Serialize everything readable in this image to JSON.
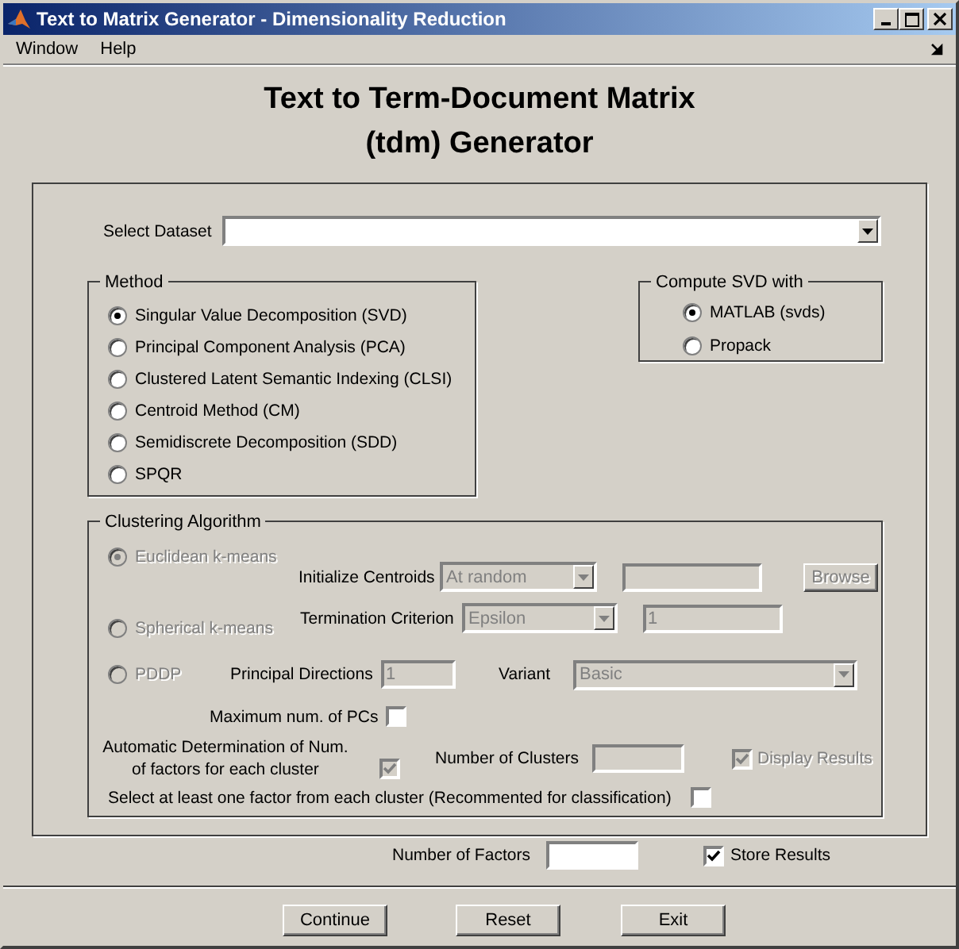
{
  "window": {
    "title": "Text to Matrix Generator - Dimensionality Reduction"
  },
  "menu": [
    "Window",
    "Help"
  ],
  "heading_lines": [
    "Text to Term-Document Matrix",
    "(tdm) Generator"
  ],
  "dataset": {
    "label": "Select Dataset"
  },
  "method": {
    "title": "Method",
    "options": [
      {
        "label": "Singular Value Decomposition (SVD)",
        "selected": true
      },
      {
        "label": "Principal Component Analysis (PCA)",
        "selected": false
      },
      {
        "label": "Clustered Latent Semantic Indexing (CLSI)",
        "selected": false
      },
      {
        "label": "Centroid Method (CM)",
        "selected": false
      },
      {
        "label": "Semidiscrete Decomposition (SDD)",
        "selected": false
      },
      {
        "label": "SPQR",
        "selected": false
      }
    ]
  },
  "svd": {
    "title": "Compute SVD with",
    "options": [
      {
        "label": "MATLAB (svds)",
        "selected": true
      },
      {
        "label": "Propack",
        "selected": false
      }
    ]
  },
  "clustering": {
    "title": "Clustering Algorithm",
    "disabled": true,
    "algorithms": [
      {
        "label": "Euclidean k-means",
        "selected": true
      },
      {
        "label": "Spherical k-means",
        "selected": false
      },
      {
        "label": "PDDP",
        "selected": false
      }
    ],
    "init_centroids": {
      "label": "Initialize Centroids",
      "value": "At random"
    },
    "browse": "Browse",
    "termination": {
      "label": "Termination Criterion",
      "value": "Epsilon",
      "tolerance": "1"
    },
    "principal_directions": {
      "label": "Principal Directions",
      "value": "1"
    },
    "variant": {
      "label": "Variant",
      "value": "Basic"
    },
    "max_pcs": {
      "label": "Maximum num. of PCs",
      "checked": false,
      "disabled": false
    },
    "auto_factors": {
      "label_lines": [
        "Automatic Determination of Num.",
        "of factors for each cluster"
      ],
      "checked": true,
      "disabled": true
    },
    "num_clusters": {
      "label": "Number of Clusters"
    },
    "display_results": {
      "label": "Display Results",
      "checked": true,
      "disabled": true
    },
    "select_one": {
      "label": "Select at least one factor from each cluster (Recommented for classification)",
      "checked": false,
      "disabled": false
    }
  },
  "num_factors": {
    "label": "Number of Factors"
  },
  "store_results": {
    "label": "Store Results",
    "checked": true,
    "disabled": false
  },
  "buttons": [
    "Continue",
    "Reset",
    "Exit"
  ]
}
